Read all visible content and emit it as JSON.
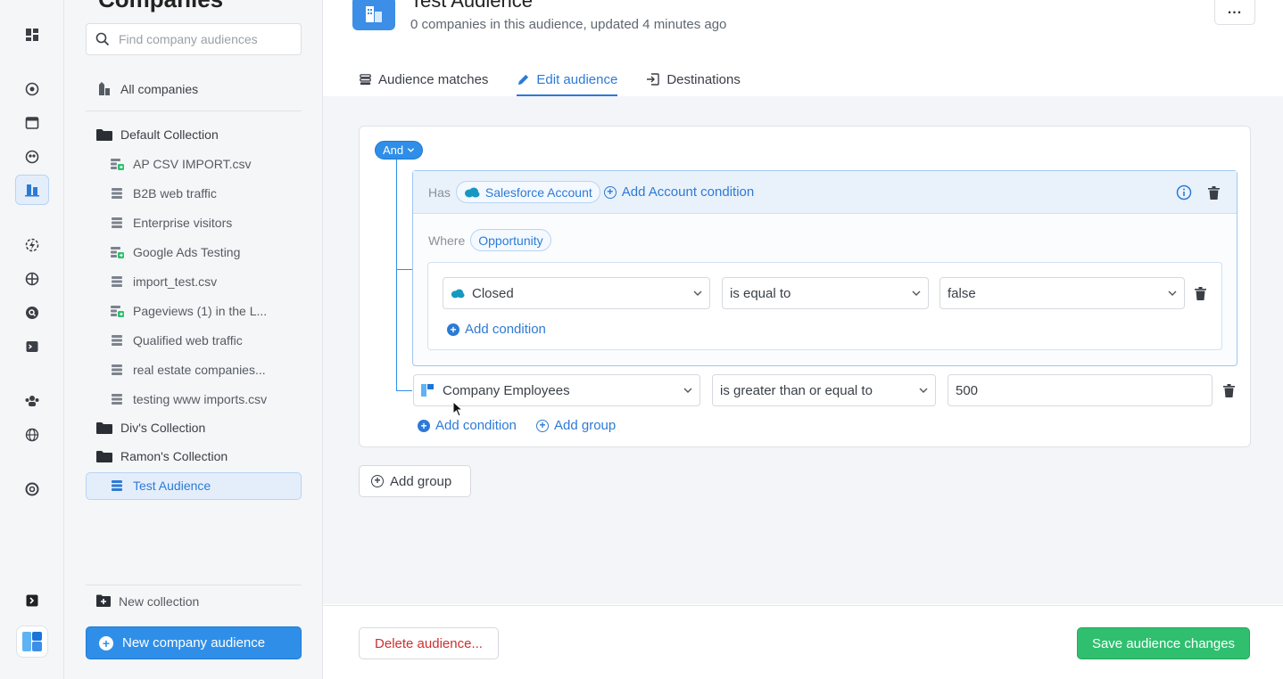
{
  "sidebar": {
    "title": "Companies",
    "search_placeholder": "Find company audiences",
    "all_companies": "All companies",
    "collections": [
      {
        "name": "Default Collection",
        "items": [
          {
            "label": "AP CSV IMPORT.csv",
            "icon": "import-list-icon"
          },
          {
            "label": "B2B web traffic",
            "icon": "list-icon"
          },
          {
            "label": "Enterprise visitors",
            "icon": "list-icon"
          },
          {
            "label": "Google Ads Testing",
            "icon": "import-list-icon"
          },
          {
            "label": "import_test.csv",
            "icon": "list-icon"
          },
          {
            "label": "Pageviews (1) in the L...",
            "icon": "import-list-icon"
          },
          {
            "label": "Qualified web traffic",
            "icon": "list-icon"
          },
          {
            "label": "real estate companies...",
            "icon": "list-icon"
          },
          {
            "label": "testing www imports.csv",
            "icon": "list-icon"
          }
        ]
      },
      {
        "name": "Div's Collection",
        "items": []
      },
      {
        "name": "Ramon's Collection",
        "items": [
          {
            "label": "Test Audience",
            "icon": "list-icon",
            "selected": true
          }
        ]
      }
    ],
    "new_collection": "New collection",
    "new_audience_button": "New company audience"
  },
  "header": {
    "title": "Test Audience",
    "subtitle": "0 companies in this audience, updated 4 minutes ago",
    "more_label": "..."
  },
  "tabs": [
    {
      "label": "Audience matches",
      "icon": "list-icon",
      "active": false
    },
    {
      "label": "Edit audience",
      "icon": "pencil-icon",
      "active": true
    },
    {
      "label": "Destinations",
      "icon": "export-icon",
      "active": false
    }
  ],
  "editor": {
    "operator": "And",
    "group": {
      "has_label": "Has",
      "object_chip": "Salesforce Account",
      "add_account_condition": "Add Account condition",
      "where_label": "Where",
      "where_chip": "Opportunity",
      "condition": {
        "field": "Closed",
        "operator": "is equal to",
        "value": "false"
      },
      "add_condition": "Add condition"
    },
    "condition2": {
      "field": "Company Employees",
      "operator": "is greater than or equal to",
      "value": "500"
    },
    "add_condition": "Add condition",
    "add_group_inline": "Add group",
    "add_group_button": "Add group"
  },
  "footer": {
    "delete_label": "Delete audience...",
    "save_label": "Save audience changes"
  },
  "colors": {
    "accent": "#2f8fe8",
    "save": "#2fbf6f",
    "danger": "#cf2e2e",
    "salesforce": "#1798c1"
  }
}
